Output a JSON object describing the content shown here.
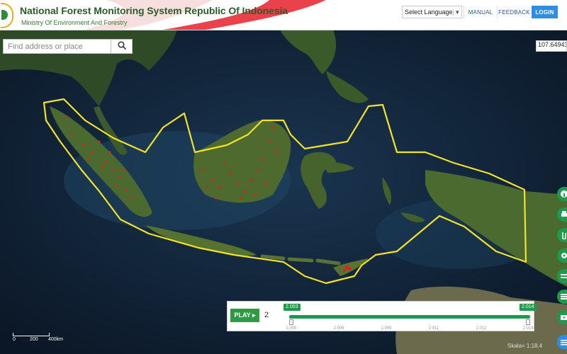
{
  "header": {
    "title": "National Forest Monitoring System Republic Of Indonesia",
    "subtitle": "Ministry Of Environment And Forestry",
    "language_select": "Select Language",
    "manual_label": "MANUAL",
    "feedback_label": "FEEDBACK",
    "login_label": "LOGIN"
  },
  "search": {
    "placeholder": "Find address or place",
    "value": ""
  },
  "coordinates": "107.64941,",
  "side_toolbar": {
    "buttons": [
      "info-icon",
      "print-icon",
      "attach-icon",
      "settings-icon",
      "layers-icon",
      "list-icon",
      "video-icon",
      "menu-icon"
    ]
  },
  "timeline": {
    "play_label": "PLAY ▸",
    "speed": "2",
    "start_year": "2.003",
    "end_year": "2.014",
    "ticks": [
      "2.005",
      "2.006",
      "2.009",
      "2.011",
      "2.012",
      "2.014"
    ]
  },
  "scale_bar": {
    "labels": [
      "0",
      "200",
      "400km"
    ]
  },
  "scale_text": "Skala= 1:18,4"
}
